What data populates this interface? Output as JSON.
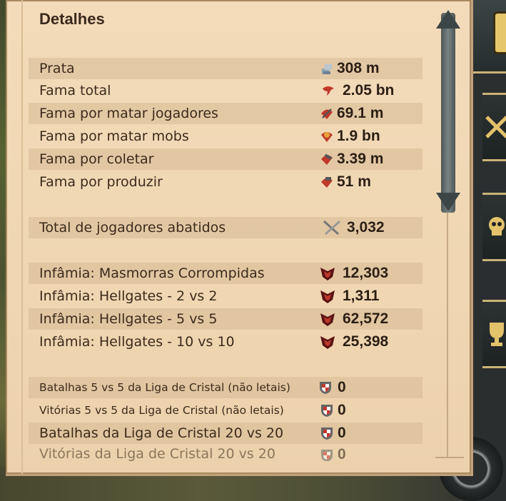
{
  "panel": {
    "title": "Detalhes"
  },
  "rows": [
    {
      "label": "Prata",
      "value": "308 m",
      "icon": "silver-coins-icon"
    },
    {
      "label": "Fama total",
      "value": "2.05 bn",
      "icon": "fame-icon"
    },
    {
      "label": "Fama por matar jogadores",
      "value": "69.1 m",
      "icon": "pvp-fame-icon"
    },
    {
      "label": "Fama por matar mobs",
      "value": "1.9 bn",
      "icon": "pve-fame-icon"
    },
    {
      "label": "Fama por coletar",
      "value": "3.39 m",
      "icon": "gathering-fame-icon"
    },
    {
      "label": "Fama por produzir",
      "value": "51 m",
      "icon": "crafting-fame-icon"
    },
    {
      "label": "Total de jogadores abatidos",
      "value": "3,032",
      "icon": "crossed-swords-icon"
    },
    {
      "label": "Infâmia: Masmorras Corrompidas",
      "value": "12,303",
      "icon": "infamy-icon"
    },
    {
      "label": "Infâmia: Hellgates - 2 vs 2",
      "value": "1,311",
      "icon": "infamy-icon"
    },
    {
      "label": "Infâmia: Hellgates - 5 vs 5",
      "value": "62,572",
      "icon": "infamy-icon"
    },
    {
      "label": "Infâmia: Hellgates - 10 vs 10",
      "value": "25,398",
      "icon": "infamy-icon"
    },
    {
      "label": "Batalhas 5 vs 5 da Liga de Cristal (não letais)",
      "value": "0",
      "icon": "crystal-league-shield-icon"
    },
    {
      "label": "Vitórias 5 vs 5 da Liga de Cristal (não letais)",
      "value": "0",
      "icon": "crystal-league-shield-icon"
    },
    {
      "label": "Batalhas da Liga de Cristal 20 vs 20",
      "value": "0",
      "icon": "crystal-league-shield-icon"
    },
    {
      "label": "Vitórias da Liga de Cristal 20 vs 20",
      "value": "0",
      "icon": "crystal-league-shield-icon"
    }
  ],
  "colors": {
    "parchment": "#f0d6b2",
    "row_shade": "#dcbb96",
    "text": "#3b2a1d",
    "fame_red": "#c0392b",
    "infamy_dark_red": "#5a1414"
  }
}
